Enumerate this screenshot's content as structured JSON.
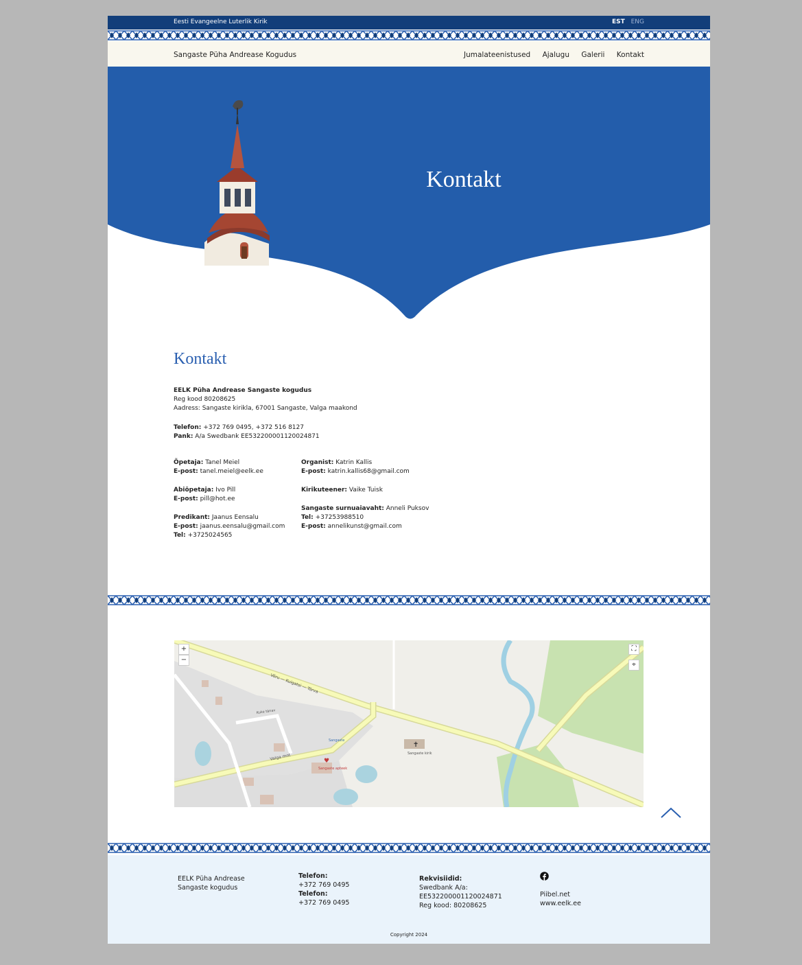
{
  "topbar": {
    "org": "Eesti Evangeelne Luterlik Kirik",
    "lang_active": "EST",
    "lang_other": "ENG"
  },
  "nav": {
    "site": "Sangaste Püha Andrease Kogudus",
    "links": [
      "Jumalateenistused",
      "Ajalugu",
      "Galerii",
      "Kontakt"
    ]
  },
  "hero": {
    "title": "Kontakt"
  },
  "contact": {
    "heading": "Kontakt",
    "org_name": "EELK Püha Andrease Sangaste kogudus",
    "reg": "Reg kood 80208625",
    "address": "Aadress: Sangaste kirikla, 67001 Sangaste, Valga maakond",
    "phone_label": "Telefon:",
    "phone": " +372 769 0495, +372 516 8127",
    "bank_label": "Pank:",
    "bank": " A/a Swedbank EE532200001120024871"
  },
  "people_left": [
    {
      "role": "Õpetaja:",
      "name": " Tanel Meiel",
      "l2": "E-post:",
      "v2": " tanel.meiel@eelk.ee"
    },
    {
      "role": "Abiõpetaja:",
      "name": " Ivo Pill",
      "l2": "E-post:",
      "v2": " pill@hot.ee"
    },
    {
      "role": "Predikant:",
      "name": " Jaanus Eensalu",
      "l2": "E-post:",
      "v2": " jaanus.eensalu@gmail.com",
      "l3": "Tel:",
      "v3": " +3725024565"
    }
  ],
  "people_right": [
    {
      "role": "Organist:",
      "name": " Katrin Kallis",
      "l2": "E-post:",
      "v2": " katrin.kallis68@gmail.com"
    },
    {
      "role": "Kirikuteener:",
      "name": " Vaike Tuisk"
    },
    {
      "role": "Sangaste surnuaiavaht:",
      "name": " Anneli Puksov",
      "l2": "Tel:",
      "v2": " +37253988510",
      "l3": "E-post:",
      "v3": " annelikunst@gmail.com"
    }
  ],
  "map": {
    "zoom_in": "+",
    "zoom_out": "−",
    "labels": [
      "Võru — Kuigatsi — Tõrva",
      "Valga mnt",
      "Kuke tänav",
      "Sangaste kirik",
      "Sangaste apteek",
      "Sangaste"
    ]
  },
  "footer": {
    "org": "EELK Püha Andrease\nSangaste kogudus",
    "tel_label1": "Telefon:",
    "tel1": "+372 769 0495",
    "tel_label2": "Telefon:",
    "tel2": "+372 769 0495",
    "rek_label": "Rekvisiidid:",
    "rek1": "Swedbank A/a:",
    "rek2": "EE532200001120024871",
    "rek3": "Reg kood: 80208625",
    "link1": "Piibel.net",
    "link2": "www.eelk.ee",
    "copyright": "Copyright 2024"
  },
  "colors": {
    "hero_blue": "#235dab",
    "topbar": "#123e7a",
    "heading_blue": "#2a5fb0",
    "footer_bg": "#eaf3fb"
  }
}
